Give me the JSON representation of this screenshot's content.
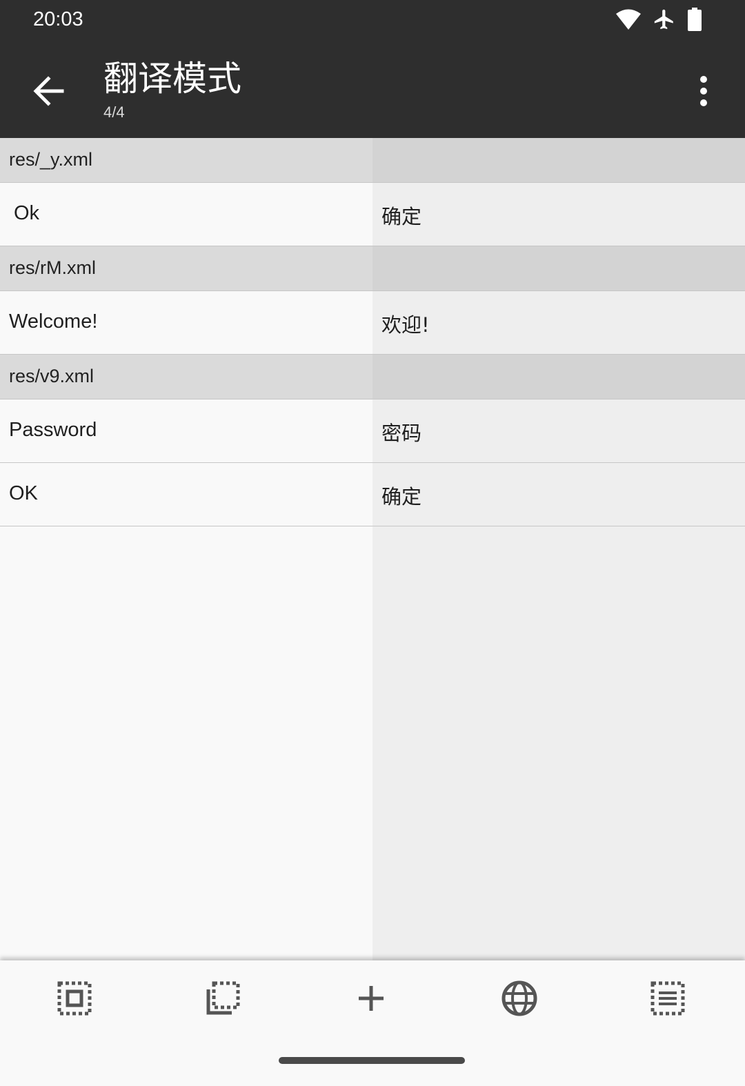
{
  "status_bar": {
    "time": "20:03",
    "icons": [
      "wifi-icon",
      "airplane-icon",
      "battery-icon"
    ]
  },
  "app_bar": {
    "title": "翻译模式",
    "subtitle": "4/4",
    "back_icon": "arrow-back-icon",
    "overflow_icon": "more-vert-icon"
  },
  "groups": [
    {
      "path": "res/_y.xml",
      "entries": [
        {
          "source": "Ok",
          "translation": "确定"
        }
      ]
    },
    {
      "path": "res/rM.xml",
      "entries": [
        {
          "source": "Welcome!",
          "translation": "欢迎!"
        }
      ]
    },
    {
      "path": "res/v9.xml",
      "entries": [
        {
          "source": "Password",
          "translation": "密码"
        },
        {
          "source": "OK",
          "translation": "确定"
        }
      ]
    }
  ],
  "toolbar": {
    "items": [
      "select-all-icon",
      "select-range-icon",
      "add-icon",
      "translate-globe-icon",
      "select-list-icon"
    ]
  },
  "colors": {
    "app_bar": "#2e2e2e",
    "group_header": "#dadada",
    "left_column": "#f9f9f9",
    "right_column": "#eeeeee"
  }
}
